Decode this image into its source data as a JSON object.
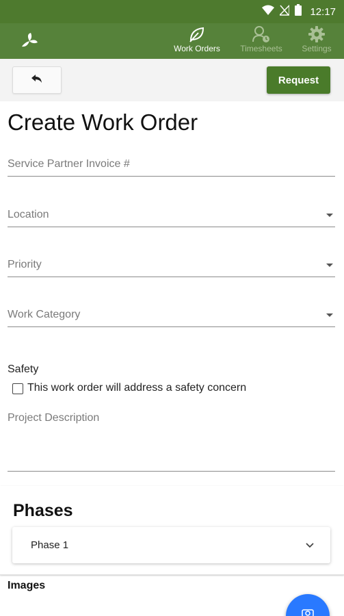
{
  "status_bar": {
    "time": "12:17",
    "icons": [
      "wifi-icon",
      "no-signal-icon",
      "battery-icon"
    ]
  },
  "app_bar": {
    "logo": "leaf-logo-icon",
    "tabs": [
      {
        "label": "Work Orders",
        "icon": "leaf-icon",
        "active": true
      },
      {
        "label": "Timesheets",
        "icon": "person-clock-icon",
        "active": false
      },
      {
        "label": "Settings",
        "icon": "gear-icon",
        "active": false
      }
    ]
  },
  "toolbar": {
    "back_icon": "reply-arrow-icon",
    "request_label": "Request"
  },
  "form": {
    "title": "Create Work Order",
    "fields": {
      "invoice_label": "Service Partner Invoice #",
      "location_label": "Location",
      "priority_label": "Priority",
      "category_label": "Work Category"
    },
    "safety": {
      "label": "Safety",
      "checkbox_text": "This work order will address a safety concern",
      "checked": false
    },
    "description_label": "Project Description"
  },
  "phases": {
    "title": "Phases",
    "items": [
      {
        "label": "Phase 1"
      }
    ]
  },
  "images": {
    "title": "Images"
  },
  "colors": {
    "status_bar": "#4e7a2e",
    "app_bar": "#56823a",
    "primary_button": "#4a7b2a",
    "fab": "#2979ff"
  }
}
